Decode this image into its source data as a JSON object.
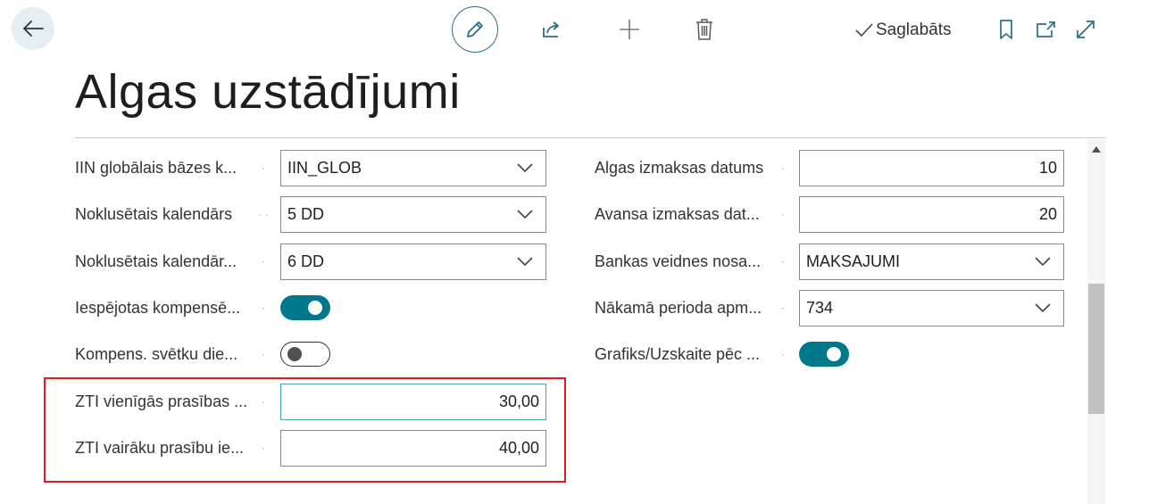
{
  "toolbar": {
    "saved_label": "Saglabāts"
  },
  "page_title": "Algas uzstādījumi",
  "left_fields": [
    {
      "label": "IIN globālais bāzes k...",
      "type": "dropdown",
      "value": "IIN_GLOB"
    },
    {
      "label": "Noklusētais kalendārs",
      "type": "dropdown",
      "value": "5 DD"
    },
    {
      "label": "Noklusētais kalendār...",
      "type": "dropdown",
      "value": "6 DD"
    },
    {
      "label": "Iespējotas kompensē...",
      "type": "toggle",
      "value": "on"
    },
    {
      "label": "Kompens. svētku die...",
      "type": "toggle",
      "value": "off"
    },
    {
      "label": "ZTI vienīgās prasības ...",
      "type": "number",
      "value": "30,00"
    },
    {
      "label": "ZTI vairāku prasību ie...",
      "type": "number",
      "value": "40,00"
    }
  ],
  "right_fields": [
    {
      "label": "Algas izmaksas datums",
      "type": "number",
      "value": "10"
    },
    {
      "label": "Avansa izmaksas dat...",
      "type": "number",
      "value": "20"
    },
    {
      "label": "Bankas veidnes nosa...",
      "type": "dropdown",
      "value": "MAKSAJUMI"
    },
    {
      "label": "Nākamā perioda apm...",
      "type": "dropdown",
      "value": "734"
    },
    {
      "label": "Grafiks/Uzskaite pēc ...",
      "type": "toggle",
      "value": "on"
    }
  ],
  "colors": {
    "accent": "#00788c",
    "highlight": "#e01b1b",
    "back_button_bg": "#e3eff3"
  },
  "icons": [
    "back-arrow-icon",
    "pencil-icon",
    "share-icon",
    "plus-icon",
    "trash-icon",
    "checkmark-icon",
    "bookmark-icon",
    "open-new-window-icon",
    "expand-icon",
    "chevron-down-icon",
    "scroll-up-arrow-icon"
  ]
}
